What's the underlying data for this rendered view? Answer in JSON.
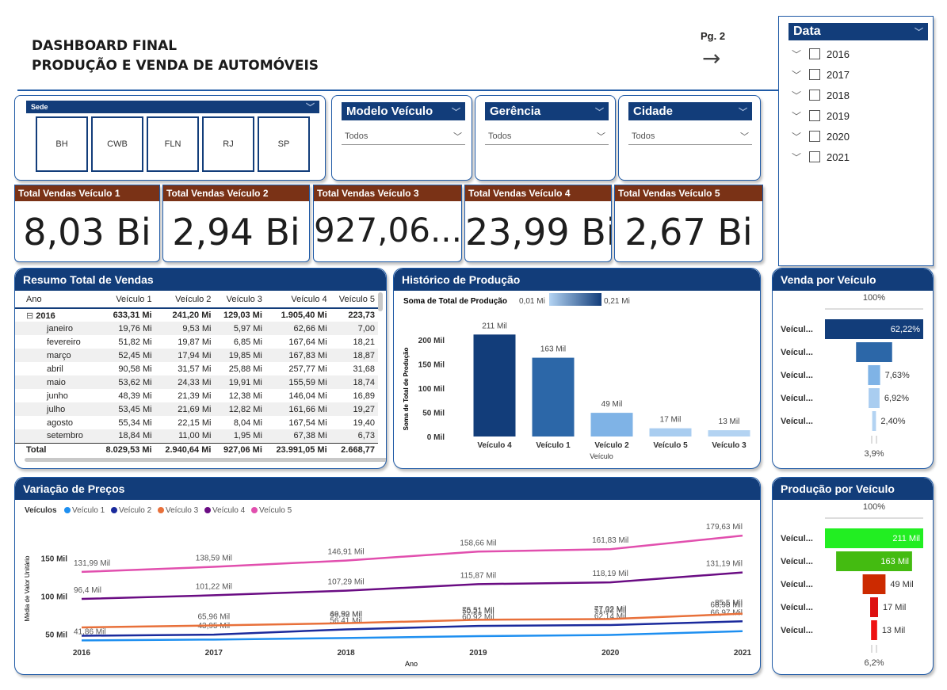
{
  "header": {
    "line1": "DASHBOARD FINAL",
    "line2": "PRODUÇÃO E VENDA DE AUTOMÓVEIS",
    "page_link": "Pg. 2",
    "arrow": "→"
  },
  "sede": {
    "title": "Sede",
    "buttons": [
      "BH",
      "CWB",
      "FLN",
      "RJ",
      "SP"
    ]
  },
  "slicers": [
    {
      "title": "Modelo Veículo",
      "value": "Todos"
    },
    {
      "title": "Gerência",
      "value": "Todos"
    },
    {
      "title": "Cidade",
      "value": "Todos"
    }
  ],
  "date_slicer": {
    "title": "Data",
    "years": [
      "2016",
      "2017",
      "2018",
      "2019",
      "2020",
      "2021"
    ]
  },
  "kpis": [
    {
      "title": "Total Vendas Veículo 1",
      "value": "8,03 Bi"
    },
    {
      "title": "Total Vendas Veículo 2",
      "value": "2,94 Bi"
    },
    {
      "title": "Total Vendas Veículo 3",
      "value": "927,06..."
    },
    {
      "title": "Total Vendas Veículo 4",
      "value": "23,99 Bi"
    },
    {
      "title": "Total Vendas Veículo 5",
      "value": "2,67 Bi"
    }
  ],
  "resumo": {
    "title": "Resumo Total de Vendas",
    "columns": [
      "Ano",
      "Veículo 1",
      "Veículo 2",
      "Veículo 3",
      "Veículo 4",
      "Veículo 5"
    ],
    "year_row": [
      "2016",
      "633,31 Mi",
      "241,20 Mi",
      "129,03 Mi",
      "1.905,40 Mi",
      "223,73"
    ],
    "expand_icon": "⊟",
    "months": [
      [
        "janeiro",
        "19,76 Mi",
        "9,53 Mi",
        "5,97 Mi",
        "62,66 Mi",
        "7,00"
      ],
      [
        "fevereiro",
        "51,82 Mi",
        "19,87 Mi",
        "6,85 Mi",
        "167,64 Mi",
        "18,21"
      ],
      [
        "março",
        "52,45 Mi",
        "17,94 Mi",
        "19,85 Mi",
        "167,83 Mi",
        "18,87"
      ],
      [
        "abril",
        "90,58 Mi",
        "31,57 Mi",
        "25,88 Mi",
        "257,77 Mi",
        "31,68"
      ],
      [
        "maio",
        "53,62 Mi",
        "24,33 Mi",
        "19,91 Mi",
        "155,59 Mi",
        "18,74"
      ],
      [
        "junho",
        "48,39 Mi",
        "21,39 Mi",
        "12,38 Mi",
        "146,04 Mi",
        "16,89"
      ],
      [
        "julho",
        "53,45 Mi",
        "21,69 Mi",
        "12,82 Mi",
        "161,66 Mi",
        "19,27"
      ],
      [
        "agosto",
        "55,34 Mi",
        "22,15 Mi",
        "8,04 Mi",
        "167,54 Mi",
        "19,40"
      ],
      [
        "setembro",
        "18,84 Mi",
        "11,00 Mi",
        "1,95 Mi",
        "67,38 Mi",
        "6,73"
      ]
    ],
    "total_row": [
      "Total",
      "8.029,53 Mi",
      "2.940,64 Mi",
      "927,06 Mi",
      "23.991,05 Mi",
      "2.668,77"
    ]
  },
  "historico": {
    "title": "Histórico de Produção",
    "legend_label": "Soma de Total de Produção",
    "legend_min": "0,01 Mi",
    "legend_max": "0,21 Mi"
  },
  "chart_data": [
    {
      "type": "bar",
      "title": "Histórico de Produção",
      "xlabel": "Veículo",
      "ylabel": "Soma de Total de Produção",
      "categories": [
        "Veículo 4",
        "Veículo 1",
        "Veículo 2",
        "Veículo 5",
        "Veículo 3"
      ],
      "values": [
        211,
        163,
        49,
        17,
        13
      ],
      "data_labels": [
        "211 Mil",
        "163 Mil",
        "49 Mil",
        "17 Mil",
        "13 Mil"
      ],
      "colors": [
        "#123d7a",
        "#2c67a8",
        "#7fb3e6",
        "#a9cdf0",
        "#b3d3f2"
      ],
      "yticks": [
        "0 Mil",
        "50 Mil",
        "100 Mil",
        "150 Mil",
        "200 Mil"
      ],
      "ylim": [
        0,
        200
      ]
    },
    {
      "type": "line",
      "title": "Variação de Preços",
      "xlabel": "Ano",
      "ylabel": "Média de Valor Unitário",
      "legend_title": "Veículos",
      "x": [
        "2016",
        "2017",
        "2018",
        "2019",
        "2020",
        "2021"
      ],
      "yticks": [
        "50 Mil",
        "100 Mil",
        "150 Mil"
      ],
      "ylim": [
        35,
        185
      ],
      "series": [
        {
          "name": "Veículo 1",
          "color": "#1e8ff0",
          "values": [
            41.86,
            43.0,
            45.0,
            47.5,
            49.0,
            54.0
          ],
          "labels": [
            "41,86 Mil",
            "",
            "",
            "",
            "",
            ""
          ]
        },
        {
          "name": "Veículo 2",
          "color": "#1a2a9c",
          "values": [
            48.0,
            49.5,
            56.41,
            60.92,
            62.14,
            66.97
          ],
          "labels": [
            "",
            "43,95 Mil",
            "56,41 Mil",
            "60,92 Mil",
            "62,14 Mil",
            "66,97 Mil"
          ]
        },
        {
          "name": "Veículo 3",
          "color": "#e8703a",
          "values": [
            59.0,
            61.5,
            64.5,
            69.0,
            70.0,
            77.0
          ],
          "labels": [
            "",
            "",
            "46,59 Mil",
            "50,21 Mil",
            "51,32 Mil",
            "68,98 Mil"
          ]
        },
        {
          "name": "Veículo 4",
          "color": "#6a0c83",
          "values": [
            96.4,
            101.22,
            107.29,
            115.87,
            118.19,
            131.19
          ],
          "labels": [
            "96,4 Mil",
            "101,22 Mil",
            "107,29 Mil",
            "115,87 Mil",
            "118,19 Mil",
            "131,19 Mil"
          ]
        },
        {
          "name": "Veículo 5",
          "color": "#e14fae",
          "values": [
            131.99,
            138.59,
            146.91,
            158.66,
            161.83,
            179.63
          ],
          "labels": [
            "131,99 Mil",
            "138,59 Mil",
            "146,91 Mil",
            "158,66 Mil",
            "161,83 Mil",
            "179,63 Mil"
          ]
        }
      ],
      "extra_labels": [
        "65,96 Mil",
        "69,92 Mil",
        "75,51 Mil",
        "77,02 Mil",
        "85,5 Mil"
      ]
    },
    {
      "type": "bar",
      "title": "Venda por Veículo",
      "categories": [
        "Veícul...",
        "Veícul...",
        "Veícul...",
        "Veícul...",
        "Veícul..."
      ],
      "values": [
        62.22,
        22.83,
        7.63,
        6.92,
        2.4
      ],
      "data_labels": [
        "62,22%",
        "",
        "7,63%",
        "6,92%",
        "2,40%"
      ],
      "colors": [
        "#123d7a",
        "#2c67a8",
        "#7fb3e6",
        "#a9cdf0",
        "#b3d3f2"
      ],
      "top_label": "100%",
      "bottom_label": "3,9%"
    },
    {
      "type": "bar",
      "title": "Produção por Veículo",
      "categories": [
        "Veícul...",
        "Veícul...",
        "Veícul...",
        "Veícul...",
        "Veícul..."
      ],
      "values": [
        211,
        163,
        49,
        17,
        13
      ],
      "data_labels": [
        "211 Mil",
        "163 Mil",
        "49 Mil",
        "17 Mil",
        "13 Mil"
      ],
      "colors": [
        "#22ee22",
        "#44bb11",
        "#cc2a00",
        "#dd1111",
        "#ee1111"
      ],
      "top_label": "100%",
      "bottom_label": "6,2%"
    }
  ],
  "variacao": {
    "title": "Variação de Preços"
  }
}
